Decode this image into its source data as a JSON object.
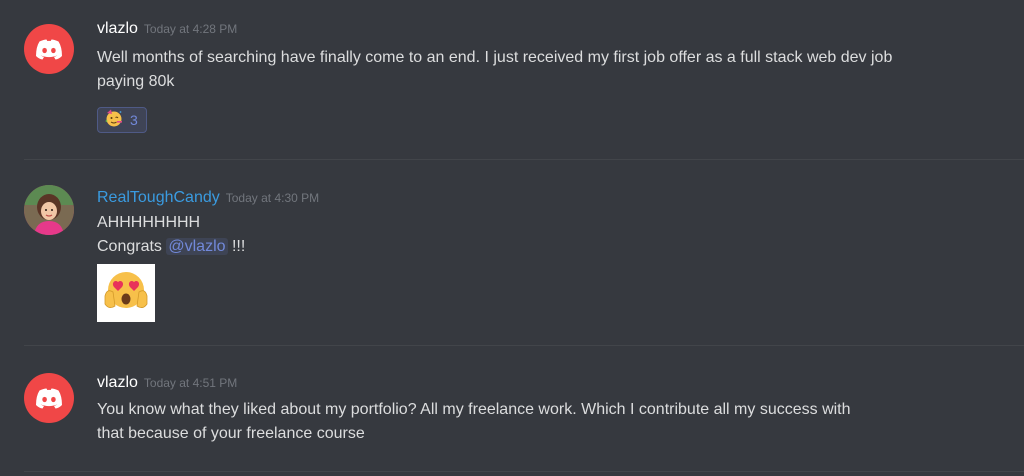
{
  "messages": [
    {
      "username": "vlazlo",
      "timestamp": "Today at 4:28 PM",
      "lines": [
        "Well months of searching have finally come to an end. I just received my first job offer as a full stack web dev job",
        "paying 80k"
      ],
      "reaction": {
        "emoji": "party-face-icon",
        "count": "3"
      },
      "avatar": "discord-logo-icon"
    },
    {
      "username": "RealToughCandy",
      "timestamp": "Today at 4:30 PM",
      "line1": "AHHHHHHHH",
      "line2_prefix": "Congrats",
      "mention": "@vlazlo",
      "line2_suffix": "!!!",
      "attachment": "heart-eyes-scream-emoji",
      "avatar": "user-photo"
    },
    {
      "username": "vlazlo",
      "timestamp": "Today at 4:51 PM",
      "lines": [
        "You know what they liked about my portfolio? All my freelance work. Which I contribute all my success with",
        "that because of your freelance course"
      ],
      "avatar": "discord-logo-icon"
    }
  ],
  "colors": {
    "background": "#36393f",
    "discord_red": "#f04747",
    "username_blue": "#3a9be0",
    "mention": "#7289da",
    "text": "#dcddde",
    "timestamp": "#72767d"
  }
}
